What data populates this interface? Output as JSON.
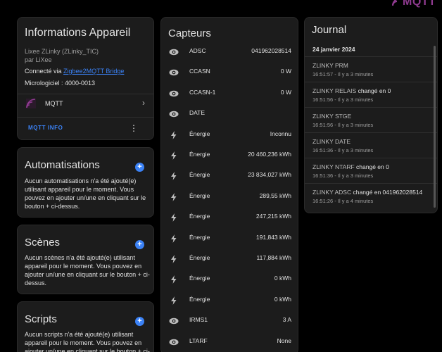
{
  "brand": {
    "logo_text": "MQTT",
    "accent": "#8e3a8f",
    "link_color": "#3b82f6"
  },
  "device": {
    "title": "Informations Appareil",
    "model": "Lixee ZLinky (ZLinky_TIC)",
    "manufacturer": "par LiXee",
    "connected_prefix": "Connecté via ",
    "connected_link": "Zigbee2MQTT Bridge",
    "firmware_label": "Micrologiciel : 4000-0013",
    "integration_label": "MQTT",
    "integration_icon": "mqtt-icon",
    "mqtt_info_label": "MQTT INFO"
  },
  "sections": [
    {
      "title": "Automatisations",
      "desc": "Aucun automatisations n'a été ajouté(e) utilisant appareil pour le moment. Vous pouvez en ajouter un/une en cliquant sur le bouton + ci-dessus."
    },
    {
      "title": "Scènes",
      "desc": "Aucun scènes n'a été ajouté(e) utilisant appareil pour le moment. Vous pouvez en ajouter un/une en cliquant sur le bouton + ci-dessus."
    },
    {
      "title": "Scripts",
      "desc": "Aucun scripts n'a été ajouté(e) utilisant appareil pour le moment. Vous pouvez en ajouter un/une en cliquant sur le bouton + ci-dessus."
    }
  ],
  "sensors": {
    "title": "Capteurs",
    "items": [
      {
        "icon": "eye-icon",
        "name": "ADSC",
        "value": "041962028514"
      },
      {
        "icon": "eye-icon",
        "name": "CCASN",
        "value": "0 W"
      },
      {
        "icon": "eye-icon",
        "name": "CCASN-1",
        "value": "0 W"
      },
      {
        "icon": "eye-icon",
        "name": "DATE",
        "value": ""
      },
      {
        "icon": "flash-icon",
        "name": "Énergie",
        "value": "Inconnu"
      },
      {
        "icon": "flash-icon",
        "name": "Énergie",
        "value": "20 460,236 kWh"
      },
      {
        "icon": "flash-icon",
        "name": "Énergie",
        "value": "23 834,027 kWh"
      },
      {
        "icon": "flash-icon",
        "name": "Énergie",
        "value": "289,55 kWh"
      },
      {
        "icon": "flash-icon",
        "name": "Énergie",
        "value": "247,215 kWh"
      },
      {
        "icon": "flash-icon",
        "name": "Énergie",
        "value": "191,843 kWh"
      },
      {
        "icon": "flash-icon",
        "name": "Énergie",
        "value": "117,884 kWh"
      },
      {
        "icon": "flash-icon",
        "name": "Énergie",
        "value": "0 kWh"
      },
      {
        "icon": "flash-icon",
        "name": "Énergie",
        "value": "0 kWh"
      },
      {
        "icon": "eye-icon",
        "name": "IRMS1",
        "value": "3 A"
      },
      {
        "icon": "eye-icon",
        "name": "LTARF",
        "value": "None"
      }
    ]
  },
  "journal": {
    "title": "Journal",
    "date": "24 janvier 2024",
    "entries": [
      {
        "name": "ZLINKY PRM",
        "action": "",
        "time": "16:51:57 - Il y a 3 minutes"
      },
      {
        "name": "ZLINKY RELAIS",
        "action": " changé en 0",
        "time": "16:51:56 - Il y a 3 minutes"
      },
      {
        "name": "ZLINKY STGE",
        "action": "",
        "time": "16:51:56 - Il y a 3 minutes"
      },
      {
        "name": "ZLINKY DATE",
        "action": "",
        "time": "16:51:36 - Il y a 3 minutes"
      },
      {
        "name": "ZLINKY NTARF",
        "action": " changé en 0",
        "time": "16:51:36 - Il y a 3 minutes"
      },
      {
        "name": "ZLINKY ADSC",
        "action": " changé en 041962028514",
        "time": "16:51:26 - Il y a 4 minutes"
      }
    ]
  }
}
